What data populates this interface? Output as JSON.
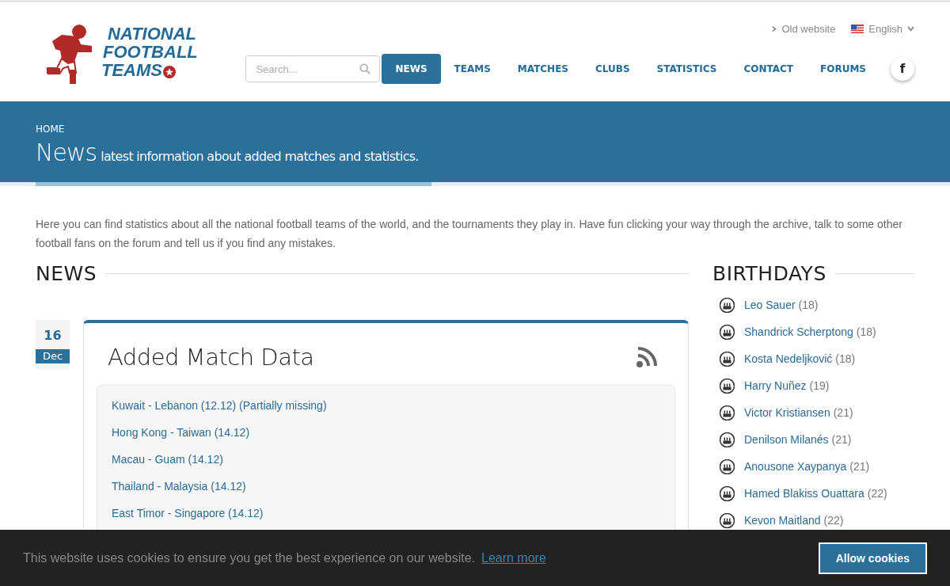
{
  "logo": {
    "lines": [
      "NATIONAL",
      "FOOTBALL",
      "TEAMS"
    ]
  },
  "top_links": {
    "old_website": "Old website",
    "language": "English"
  },
  "search": {
    "placeholder": "Search..."
  },
  "nav": [
    {
      "label": "NEWS",
      "selected": true
    },
    {
      "label": "TEAMS",
      "selected": false
    },
    {
      "label": "MATCHES",
      "selected": false
    },
    {
      "label": "CLUBS",
      "selected": false
    },
    {
      "label": "STATISTICS",
      "selected": false
    },
    {
      "label": "CONTACT",
      "selected": false
    },
    {
      "label": "FORUMS",
      "selected": false
    }
  ],
  "social": {
    "facebook": "f"
  },
  "banner": {
    "breadcrumb": "HOME",
    "title": "News",
    "subtitle": "latest information about added matches and statistics."
  },
  "intro": "Here you can find statistics about all the national football teams of the world, and the tournaments they play in. Have fun clicking your way through the archive, talk to some other football fans on the forum and tell us if you find any mistakes.",
  "news": {
    "heading": "NEWS",
    "post": {
      "day": "16",
      "month": "Dec",
      "title": "Added Match Data",
      "items": [
        "Kuwait - Lebanon (12.12) (Partially missing)",
        "Hong Kong - Taiwan (14.12)",
        "Macau - Guam (14.12)",
        "Thailand - Malaysia (14.12)",
        "East Timor - Singapore (14.12)"
      ]
    }
  },
  "birthdays": {
    "heading": "BIRTHDAYS",
    "items": [
      {
        "name": "Leo Sauer",
        "age": "(18)"
      },
      {
        "name": "Shandrick Scherptong",
        "age": "(18)"
      },
      {
        "name": "Kosta Nedeljković",
        "age": "(18)"
      },
      {
        "name": "Harry Nuñez",
        "age": "(19)"
      },
      {
        "name": "Victor Kristiansen",
        "age": "(21)"
      },
      {
        "name": "Denilson Milanés",
        "age": "(21)"
      },
      {
        "name": "Anousone Xaypanya",
        "age": "(21)"
      },
      {
        "name": "Hamed Blakiss Ouattara",
        "age": "(22)"
      },
      {
        "name": "Kevon Maitland",
        "age": "(22)"
      }
    ]
  },
  "cookie_bar": {
    "message": "This website uses cookies to ensure you get the best experience on our website.",
    "link": "Learn more",
    "button": "Allow cookies"
  }
}
